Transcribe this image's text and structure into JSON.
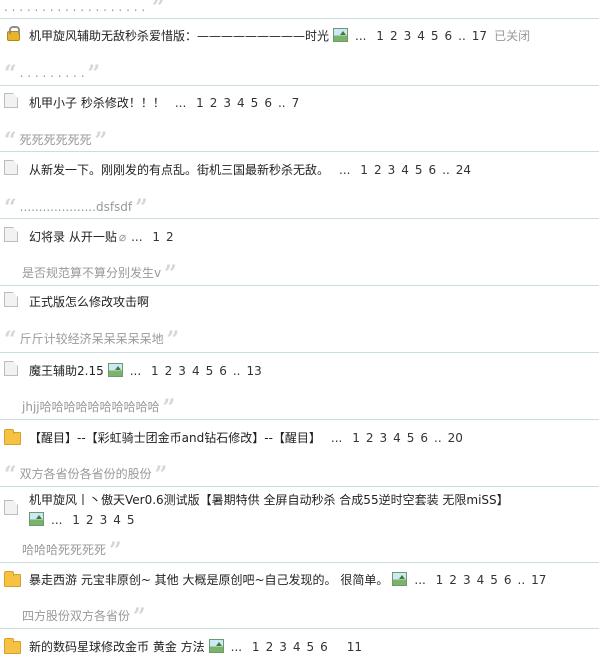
{
  "top_excerpt": {
    "text": ". . . . . . . . . . . . . . . . . . ."
  },
  "threads": [
    {
      "title": "机甲旋风辅助无敌秒杀爱惜版：—————————时光",
      "has_image": true,
      "pages": [
        "1",
        "2",
        "3",
        "4",
        "5",
        "6"
      ],
      "ellipsis": "..",
      "last": "17",
      "status": "已关闭",
      "excerpt": ". . . . . . . . ."
    },
    {
      "title": "机甲小子 秒杀修改！！！",
      "pages": [
        "1",
        "2",
        "3",
        "4",
        "5",
        "6"
      ],
      "ellipsis": "..",
      "last": "7",
      "excerpt": "死死死死死死"
    },
    {
      "title": "从新发一下。刚刚发的有点乱。街机三国最新秒杀无敌。",
      "pages": [
        "1",
        "2",
        "3",
        "4",
        "5",
        "6"
      ],
      "ellipsis": "..",
      "last": "24",
      "excerpt": "....................dsfsdf"
    },
    {
      "title": "幻将录 从开一贴",
      "has_attach": true,
      "pages": [
        "1",
        "2"
      ],
      "excerpt": "是否规范算不算分别发生v"
    },
    {
      "title": "正式版怎么修改攻击啊",
      "excerpt": "斤斤计较经济呆呆呆呆呆地"
    },
    {
      "title": "魔王辅助2.15",
      "has_image": true,
      "pages": [
        "1",
        "2",
        "3",
        "4",
        "5",
        "6"
      ],
      "ellipsis": "..",
      "last": "13",
      "excerpt": "jhjj哈哈哈哈哈哈哈哈哈哈"
    },
    {
      "title": "【醒目】--【彩虹骑士团金币and钻石修改】--【醒目】",
      "pages": [
        "1",
        "2",
        "3",
        "4",
        "5",
        "6"
      ],
      "ellipsis": "..",
      "last": "20",
      "excerpt": "双方各省份各省份的股份"
    },
    {
      "title": "机甲旋风丨丶傲天Ver0.6测试版【暑期特供 全屏自动秒杀 合成55逆时空套装 无限miSS】",
      "has_image": true,
      "pages": [
        "1",
        "2",
        "3",
        "4",
        "5"
      ],
      "excerpt": "哈哈哈死死死死"
    },
    {
      "title": "暴走西游 元宝非原创~ 其他 大概是原创吧~自己发现的。 很简单。",
      "has_image": true,
      "pages": [
        "1",
        "2",
        "3",
        "4",
        "5",
        "6"
      ],
      "ellipsis": "..",
      "last": "17",
      "excerpt": "四方股份双方各省份"
    },
    {
      "title": "新的数码星球修改金币 黄金 方法",
      "has_image": true,
      "pages": [
        "1",
        "2",
        "3",
        "4",
        "5",
        "6"
      ],
      "last": "11",
      "excerpt": ""
    }
  ],
  "more_pages_symbol": "...",
  "icons": {
    "closed": "lock-icon",
    "normal": "document-icon",
    "hot": "folder-icon",
    "image": "image-icon",
    "attachment": "paperclip-icon"
  },
  "colors": {
    "separator": "#c9dde0",
    "muted": "#999999",
    "quote": "#d6d6d6",
    "folder": "#f5c244"
  }
}
